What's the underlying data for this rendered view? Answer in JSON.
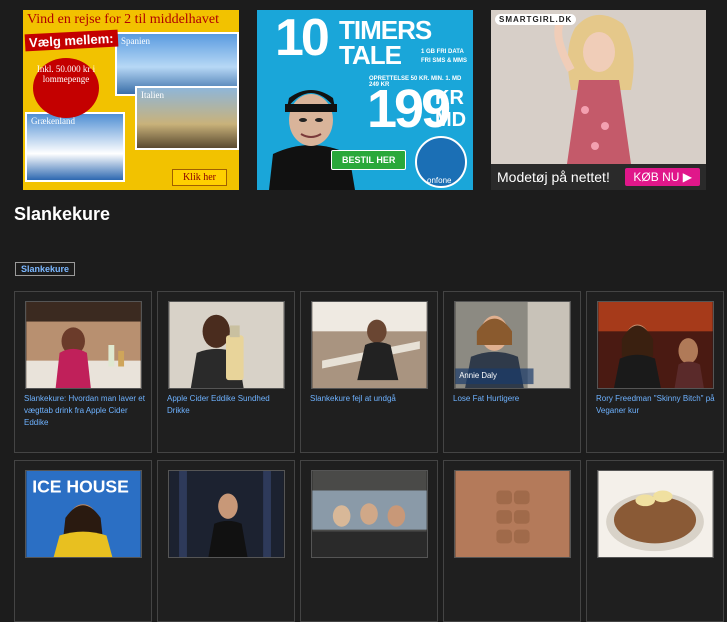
{
  "ads": {
    "ad1": {
      "headline": "Vind en rejse for 2 til middelhavet",
      "choose": "Vælg mellem:",
      "prize": "Inkl. 50.000 kr i lommepenge",
      "dest1": "Spanien",
      "dest2": "Italien",
      "dest3": "Grækenland",
      "cta": "Klik her"
    },
    "ad2": {
      "number": "10",
      "word1": "TIMERS",
      "word2": "TALE",
      "data_line1": "1 GB FRI DATA",
      "data_line2": "FRI SMS & MMS",
      "fine_print": "OPRETTELSE 50 KR. MIN. 1. MD 249 KR",
      "price": "199",
      "unit1": "KR",
      "unit2": "MD",
      "cta": "BESTIL HER",
      "brand": "onfone"
    },
    "ad3": {
      "brand": "SMARTGIRL.DK",
      "slogan": "Modetøj på nettet!",
      "cta": "KØB NU"
    }
  },
  "page": {
    "title": "Slankekure",
    "tag": "Slankekure"
  },
  "videos": [
    {
      "caption": "Slankekure: Hvordan man laver et vægttab drink fra Apple Cider Eddike"
    },
    {
      "caption": "Apple Cider Eddike Sundhed Drikke"
    },
    {
      "caption": "Slankekure fejl at undgå"
    },
    {
      "caption": "Lose Fat Hurtigere"
    },
    {
      "caption": "Rory Freedman \"Skinny Bitch\" på Veganer kur"
    },
    {
      "caption": ""
    },
    {
      "caption": ""
    },
    {
      "caption": ""
    },
    {
      "caption": ""
    },
    {
      "caption": ""
    }
  ],
  "thumb_labels": {
    "t4_name": "Annie Daly",
    "t6_sign": "ICE HOUSE"
  },
  "colors": {
    "background": "#1c1c1c",
    "link": "#6eb2ff",
    "card_border": "#444444"
  }
}
